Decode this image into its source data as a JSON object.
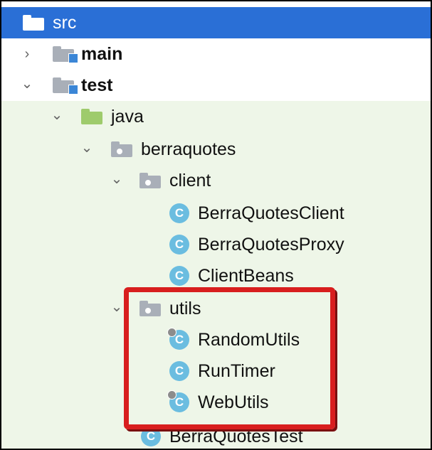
{
  "tree": {
    "root": {
      "label": "src"
    },
    "items": [
      {
        "label": "main",
        "chevron": "›"
      },
      {
        "label": "test",
        "chevron": "⌄"
      },
      {
        "label": "java",
        "chevron": "⌄"
      },
      {
        "label": "berraquotes",
        "chevron": "⌄"
      },
      {
        "label": "client",
        "chevron": "⌄"
      },
      {
        "label": "BerraQuotesClient"
      },
      {
        "label": "BerraQuotesProxy"
      },
      {
        "label": "ClientBeans"
      },
      {
        "label": "utils",
        "chevron": "⌄"
      },
      {
        "label": "RandomUtils"
      },
      {
        "label": "RunTimer"
      },
      {
        "label": "WebUtils"
      },
      {
        "label": "BerraQuotesTest"
      }
    ],
    "class_icon_letter": "C"
  },
  "colors": {
    "selection": "#2a6fd6",
    "test_background": "#eef6e8",
    "highlight_border": "#d81e1e",
    "class_icon": "#6bbde0",
    "source_folder": "#9ecb6c",
    "package_folder": "#a9afb8"
  },
  "icons": {
    "folder": "folder-icon",
    "module": "module-folder-icon",
    "source_root": "source-folder-icon",
    "package": "package-icon",
    "class": "java-class-icon"
  }
}
